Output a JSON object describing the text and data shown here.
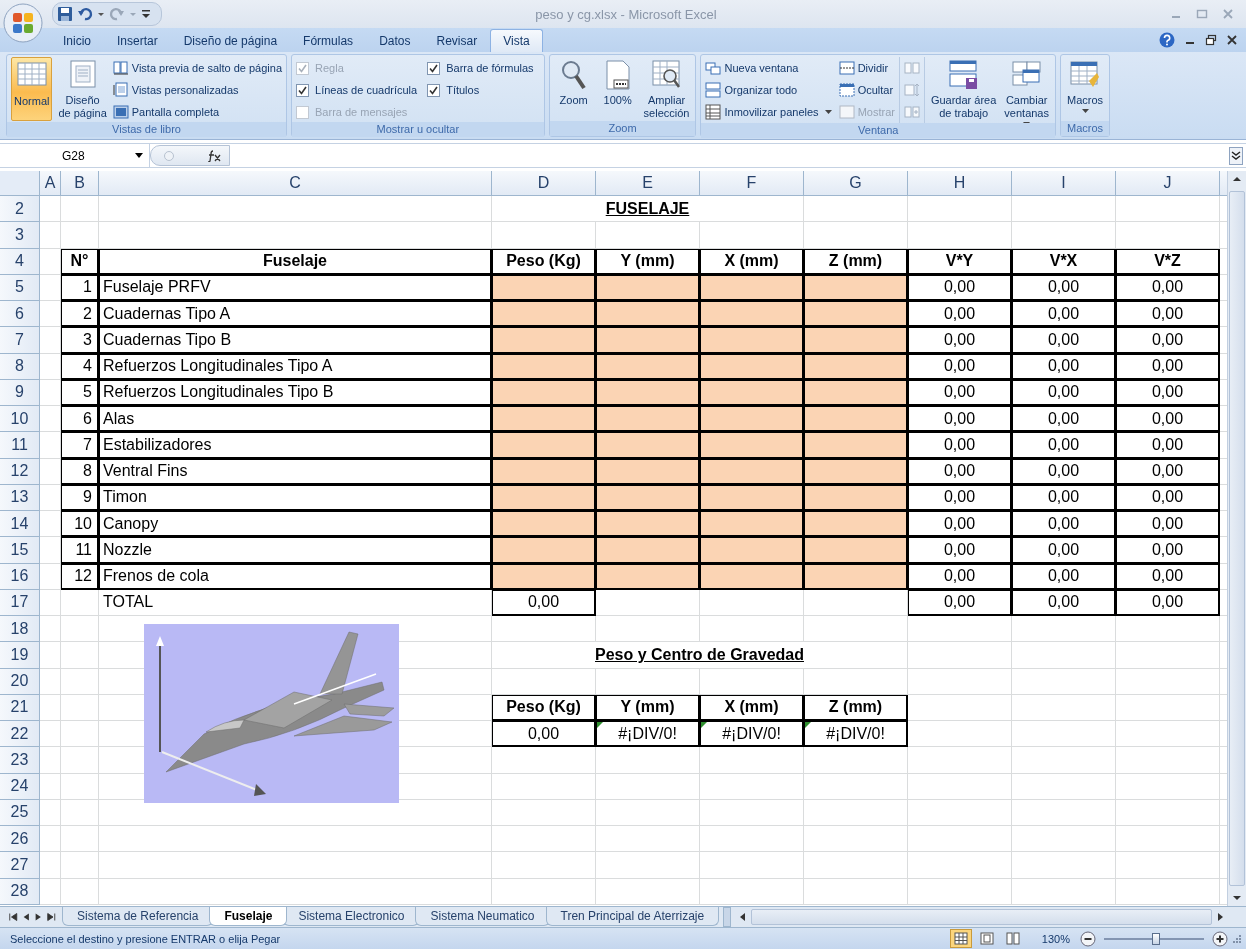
{
  "window": {
    "title": "peso y cg.xlsx - Microsoft Excel"
  },
  "ribbon": {
    "tabs": [
      {
        "label": "Inicio",
        "selected": false
      },
      {
        "label": "Insertar",
        "selected": false
      },
      {
        "label": "Diseño de página",
        "selected": false
      },
      {
        "label": "Fórmulas",
        "selected": false
      },
      {
        "label": "Datos",
        "selected": false
      },
      {
        "label": "Revisar",
        "selected": false
      },
      {
        "label": "Vista",
        "selected": true
      }
    ],
    "groups": [
      {
        "label": "Vistas de libro",
        "items": [
          {
            "kind": "large",
            "label": "Normal",
            "selected": true
          },
          {
            "kind": "large",
            "label": "Diseño\nde página",
            "selected": false
          },
          {
            "kind": "small",
            "label": "Vista previa de salto de página"
          },
          {
            "kind": "small",
            "label": "Vistas personalizadas"
          },
          {
            "kind": "small",
            "label": "Pantalla completa"
          }
        ]
      },
      {
        "label": "Mostrar u ocultar",
        "items": [
          {
            "kind": "check",
            "label": "Regla",
            "checked": true,
            "disabled": true
          },
          {
            "kind": "check",
            "label": "Líneas de cuadrícula",
            "checked": true,
            "disabled": false
          },
          {
            "kind": "check",
            "label": "Barra de mensajes",
            "checked": false,
            "disabled": true
          },
          {
            "kind": "check",
            "label": "Barra de fórmulas",
            "checked": true,
            "disabled": false
          },
          {
            "kind": "check",
            "label": "Títulos",
            "checked": true,
            "disabled": false
          }
        ]
      },
      {
        "label": "Zoom",
        "items": [
          {
            "kind": "large",
            "label": "Zoom"
          },
          {
            "kind": "large",
            "label": "100%"
          },
          {
            "kind": "large",
            "label": "Ampliar\nselección"
          }
        ]
      },
      {
        "label": "Ventana",
        "items": [
          {
            "kind": "small",
            "label": "Nueva ventana",
            "disabled": false
          },
          {
            "kind": "small",
            "label": "Organizar todo",
            "disabled": false
          },
          {
            "kind": "small",
            "label": "Inmovilizar paneles",
            "disabled": false,
            "dropdown": true
          },
          {
            "kind": "small",
            "label": "Dividir",
            "disabled": false
          },
          {
            "kind": "small",
            "label": "Ocultar",
            "disabled": false
          },
          {
            "kind": "small",
            "label": "Mostrar",
            "disabled": true
          },
          {
            "kind": "icon",
            "disabled": true
          },
          {
            "kind": "icon",
            "disabled": true
          },
          {
            "kind": "icon",
            "disabled": true
          },
          {
            "kind": "large",
            "label": "Guardar área\nde trabajo"
          },
          {
            "kind": "large",
            "label": "Cambiar\nventanas",
            "dropdown": true
          }
        ]
      },
      {
        "label": "Macros",
        "items": [
          {
            "kind": "large",
            "label": "Macros",
            "dropdown": true
          }
        ]
      }
    ]
  },
  "formula_bar": {
    "name_box": "G28"
  },
  "sheet": {
    "column_headers": [
      "A",
      "B",
      "C",
      "D",
      "E",
      "F",
      "G",
      "H",
      "I",
      "J"
    ],
    "row_numbers": [
      "2",
      "3",
      "4",
      "5",
      "6",
      "7",
      "8",
      "9",
      "10",
      "11",
      "12",
      "13",
      "14",
      "15",
      "16",
      "17",
      "18",
      "19",
      "20",
      "21",
      "22",
      "23",
      "24",
      "25",
      "26",
      "27",
      "28"
    ],
    "title": "FUSELAJE",
    "table": {
      "columns": [
        "N°",
        "Fuselaje",
        "Peso (Kg)",
        "Y (mm)",
        "X (mm)",
        "Z (mm)",
        "V*Y",
        "V*X",
        "V*Z"
      ],
      "rows": [
        {
          "number": "1",
          "item": "Fuselaje PRFV",
          "products": [
            "0,00",
            "0,00",
            "0,00"
          ]
        },
        {
          "number": "2",
          "item": "Cuadernas Tipo A",
          "products": [
            "0,00",
            "0,00",
            "0,00"
          ]
        },
        {
          "number": "3",
          "item": "Cuadernas Tipo B",
          "products": [
            "0,00",
            "0,00",
            "0,00"
          ]
        },
        {
          "number": "4",
          "item": "Refuerzos Longitudinales Tipo A",
          "products": [
            "0,00",
            "0,00",
            "0,00"
          ]
        },
        {
          "number": "5",
          "item": "Refuerzos Longitudinales Tipo B",
          "products": [
            "0,00",
            "0,00",
            "0,00"
          ]
        },
        {
          "number": "6",
          "item": "Alas",
          "products": [
            "0,00",
            "0,00",
            "0,00"
          ]
        },
        {
          "number": "7",
          "item": "Estabilizadores",
          "products": [
            "0,00",
            "0,00",
            "0,00"
          ]
        },
        {
          "number": "8",
          "item": "Ventral Fins",
          "products": [
            "0,00",
            "0,00",
            "0,00"
          ]
        },
        {
          "number": "9",
          "item": "Timon",
          "products": [
            "0,00",
            "0,00",
            "0,00"
          ]
        },
        {
          "number": "10",
          "item": "Canopy",
          "products": [
            "0,00",
            "0,00",
            "0,00"
          ]
        },
        {
          "number": "11",
          "item": "Nozzle",
          "products": [
            "0,00",
            "0,00",
            "0,00"
          ]
        },
        {
          "number": "12",
          "item": "Frenos de cola",
          "products": [
            "0,00",
            "0,00",
            "0,00"
          ]
        }
      ],
      "total": {
        "label": "TOTAL",
        "weight": "0,00",
        "products": [
          "0,00",
          "0,00",
          "0,00"
        ]
      }
    },
    "summary": {
      "title": "Peso y Centro de Gravedad",
      "columns": [
        "Peso (Kg)",
        "Y (mm)",
        "X (mm)",
        "Z (mm)"
      ],
      "cells": [
        {
          "value": "0,00",
          "flagged": false
        },
        {
          "value": "#¡DIV/0!",
          "flagged": true
        },
        {
          "value": "#¡DIV/0!",
          "flagged": true
        },
        {
          "value": "#¡DIV/0!",
          "flagged": true
        }
      ]
    }
  },
  "sheet_tabs": [
    {
      "label": "Sistema de Referencia",
      "selected": false
    },
    {
      "label": "Fuselaje",
      "selected": true
    },
    {
      "label": "Sistema Electronico",
      "selected": false
    },
    {
      "label": "Sistema Neumatico",
      "selected": false
    },
    {
      "label": "Tren Principal de Aterrizaje",
      "selected": false
    }
  ],
  "status_bar": {
    "message": "Seleccione el destino y presione ENTRAR o elija Pegar",
    "views": [
      {
        "selected": true
      },
      {
        "selected": false
      },
      {
        "selected": false
      }
    ],
    "zoom": "130%",
    "zoom_slider": {
      "level": 0.52
    }
  }
}
